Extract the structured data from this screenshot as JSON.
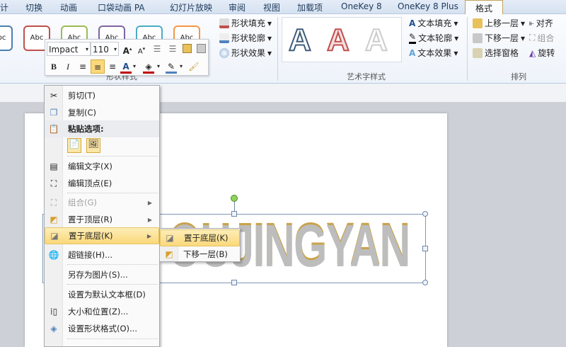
{
  "tabs": [
    "计",
    "切换",
    "动画",
    "口袋动画 PA",
    "幻灯片放映",
    "审阅",
    "视图",
    "加载项",
    "OneKey 8",
    "OneKey 8 Plus",
    "格式"
  ],
  "ribbon": {
    "shape_styles": {
      "label": "形状样式",
      "sample": "Abc",
      "fill": "形状填充",
      "outline": "形状轮廓",
      "effects": "形状效果"
    },
    "wordart_styles": {
      "label": "艺术字样式",
      "sample": "A",
      "text_fill": "文本填充",
      "text_outline": "文本轮廓",
      "text_effects": "文本效果"
    },
    "arrange": {
      "label": "排列",
      "bring_forward": "上移一层",
      "send_backward": "下移一层",
      "selection_pane": "选择窗格",
      "align": "对齐",
      "group": "组合",
      "rotate": "旋转"
    }
  },
  "mini_toolbar": {
    "font": "Impact",
    "size": "110",
    "bold": "B",
    "italic": "I"
  },
  "context_menu": {
    "items": [
      {
        "label": "剪切(T)"
      },
      {
        "label": "复制(C)"
      },
      {
        "label": "粘贴选项:"
      },
      {
        "label": "编辑文字(X)"
      },
      {
        "label": "编辑顶点(E)"
      },
      {
        "label": "组合(G)"
      },
      {
        "label": "置于顶层(R)"
      },
      {
        "label": "置于底层(K)"
      },
      {
        "label": "超链接(H)..."
      },
      {
        "label": "另存为图片(S)..."
      },
      {
        "label": "设置为默认文本框(D)"
      },
      {
        "label": "大小和位置(Z)..."
      },
      {
        "label": "设置形状格式(O)..."
      }
    ]
  },
  "submenu": {
    "items": [
      {
        "label": "置于底层(K)"
      },
      {
        "label": "下移一层(B)"
      }
    ]
  },
  "slide": {
    "wordart_text": "OUJINGYAN"
  }
}
